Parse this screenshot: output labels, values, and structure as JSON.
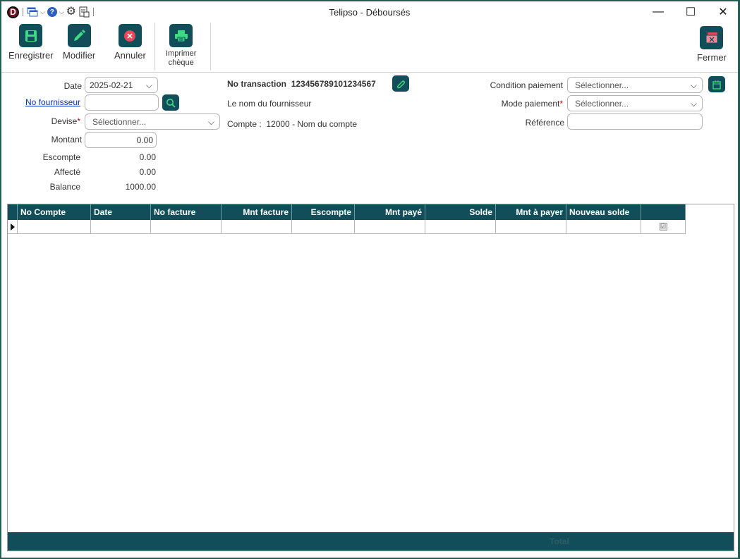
{
  "window": {
    "title": "Telipso - Déboursés",
    "logo_letter": "D",
    "controls": {
      "minimize": "—",
      "maximize": "☐",
      "close": "✕"
    }
  },
  "quick_access": {
    "help": "?",
    "settings": "⚙",
    "chevron": "⌵"
  },
  "toolbar": {
    "save": "Enregistrer",
    "edit": "Modifier",
    "cancel": "Annuler",
    "print_line1": "Imprimer",
    "print_line2": "chèque",
    "close": "Fermer"
  },
  "colors": {
    "accent": "#114e5a",
    "button_green": "#3ddc84",
    "button_red": "#e8475a",
    "link": "#0a2dcc",
    "required": "#cc0000"
  },
  "form": {
    "date_label": "Date",
    "date_value": "2025-02-21",
    "supplier_label": "No fournisseur",
    "supplier_value": "",
    "currency_label": "Devise",
    "currency_placeholder": "Sélectionner...",
    "amount_label": "Montant",
    "amount_value": "0.00",
    "discount_label": "Escompte",
    "discount_value": "0.00",
    "applied_label": "Affecté",
    "applied_value": "0.00",
    "balance_label": "Balance",
    "balance_value": "1000.00",
    "transaction_label": "No transaction",
    "transaction_value": "123456789101234567",
    "supplier_name": "Le nom du fournisseur",
    "account_label": "Compte :",
    "account_value": "12000 - Nom du compte",
    "payment_terms_label": "Condition paiement",
    "payment_terms_placeholder": "Sélectionner...",
    "payment_mode_label": "Mode paiement",
    "payment_mode_placeholder": "Sélectionner...",
    "reference_label": "Référence",
    "reference_value": "",
    "required_mark": "*"
  },
  "grid": {
    "columns": [
      "No Compte",
      "Date",
      "No facture",
      "Mnt facture",
      "Escompte",
      "Mnt payé",
      "Solde",
      "Mnt à payer",
      "Nouveau solde",
      ""
    ],
    "rows": [
      [
        "",
        "",
        "",
        "",
        "",
        "",
        "",
        "",
        "",
        "☑"
      ]
    ],
    "footer_total": "Total"
  }
}
